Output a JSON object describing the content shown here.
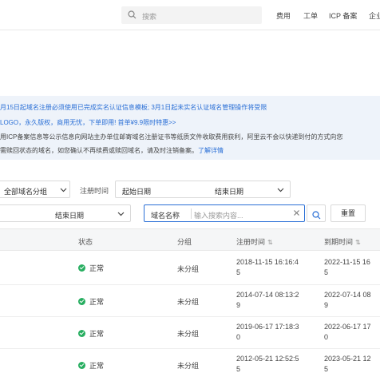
{
  "header": {
    "search_placeholder": "搜索",
    "nav": [
      "费用",
      "工单",
      "ICP 备案",
      "企业"
    ]
  },
  "notice": {
    "line1": "月15日起域名注册必须使用已完成实名认证信息模板; 3月1日起未实名认证域名管理操作将受限",
    "line2": "LOGO，永久版权，商用无忧，下单即用! 首单¥9.9限时特惠>>",
    "line3": "用ICP备案信息等公示信息向网站主办单位邮寄域名注册证书等纸质文件收取费用获利，阿里云不会以快递到付的方式向您",
    "line4_text": "需赎回状态的域名，如您确认不再续费或赎回域名，请及时注销备案。",
    "line4_link": "了解详情"
  },
  "filters": {
    "group_select": "全部域名分组",
    "reg_time_label": "注册时间",
    "start_date": "起始日期",
    "end_date": "结束日期",
    "end_date2": "结束日期",
    "field_select": "域名名称",
    "search_placeholder": "输入搜索内容...",
    "reset_button": "重置"
  },
  "table": {
    "headers": {
      "status": "状态",
      "group": "分组",
      "reg_time": "注册时间",
      "expire_time": "到期时间"
    },
    "rows": [
      {
        "status": "正常",
        "group": "未分组",
        "reg_a": "2018-11-15 16:16:4",
        "reg_b": "5",
        "exp_a": "2022-11-15 16",
        "exp_b": "5"
      },
      {
        "status": "正常",
        "group": "未分组",
        "reg_a": "2014-07-14 08:13:2",
        "reg_b": "9",
        "exp_a": "2022-07-14 08",
        "exp_b": "9"
      },
      {
        "status": "正常",
        "group": "未分组",
        "reg_a": "2019-06-17 17:18:3",
        "reg_b": "0",
        "exp_a": "2022-06-17 17",
        "exp_b": "0"
      },
      {
        "status": "正常",
        "group": "未分组",
        "reg_a": "2012-05-21 12:52:5",
        "reg_b": "5",
        "exp_a": "2023-05-21 12",
        "exp_b": "5"
      }
    ]
  },
  "colors": {
    "accent": "#2a6fd6",
    "status_ok": "#27ae60",
    "notice_bg": "#eef3fa"
  }
}
